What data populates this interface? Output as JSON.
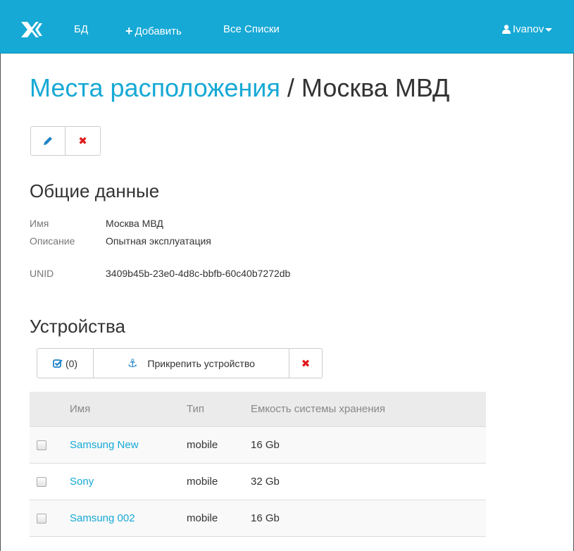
{
  "navbar": {
    "brand_color": "#ffffff",
    "bar_color": "#16a9d5",
    "items": {
      "db": "БД",
      "add": "Добавить",
      "lists": "Все Списки",
      "user": "Ivanov"
    }
  },
  "page": {
    "breadcrumb": "Места расположения",
    "separator": " / ",
    "title": "Москва МВД"
  },
  "actions": {
    "edit_icon": "pencil-icon",
    "delete_icon": "close-icon",
    "delete_glyph": "✖"
  },
  "general": {
    "title": "Общие данные",
    "fields": {
      "name_label": "Имя",
      "name_value": "Москва МВД",
      "desc_label": "Описание",
      "desc_value": "Опытная эксплуатация",
      "unid_label": "UNID",
      "unid_value": "3409b45b-23e0-4d8c-bbfb-60c40b7272db"
    }
  },
  "devices": {
    "title": "Устройства",
    "toolbar": {
      "select_count": "(0)",
      "attach_label": "Прикрепить устройство",
      "delete_glyph": "✖"
    },
    "columns": {
      "name": "Имя",
      "type": "Тип",
      "capacity": "Емкость системы хранения"
    },
    "rows": [
      {
        "name": "Samsung New",
        "type": "mobile",
        "capacity": "16 Gb"
      },
      {
        "name": "Sony",
        "type": "mobile",
        "capacity": "32 Gb"
      },
      {
        "name": "Samsung 002",
        "type": "mobile",
        "capacity": "16 Gb"
      }
    ]
  }
}
